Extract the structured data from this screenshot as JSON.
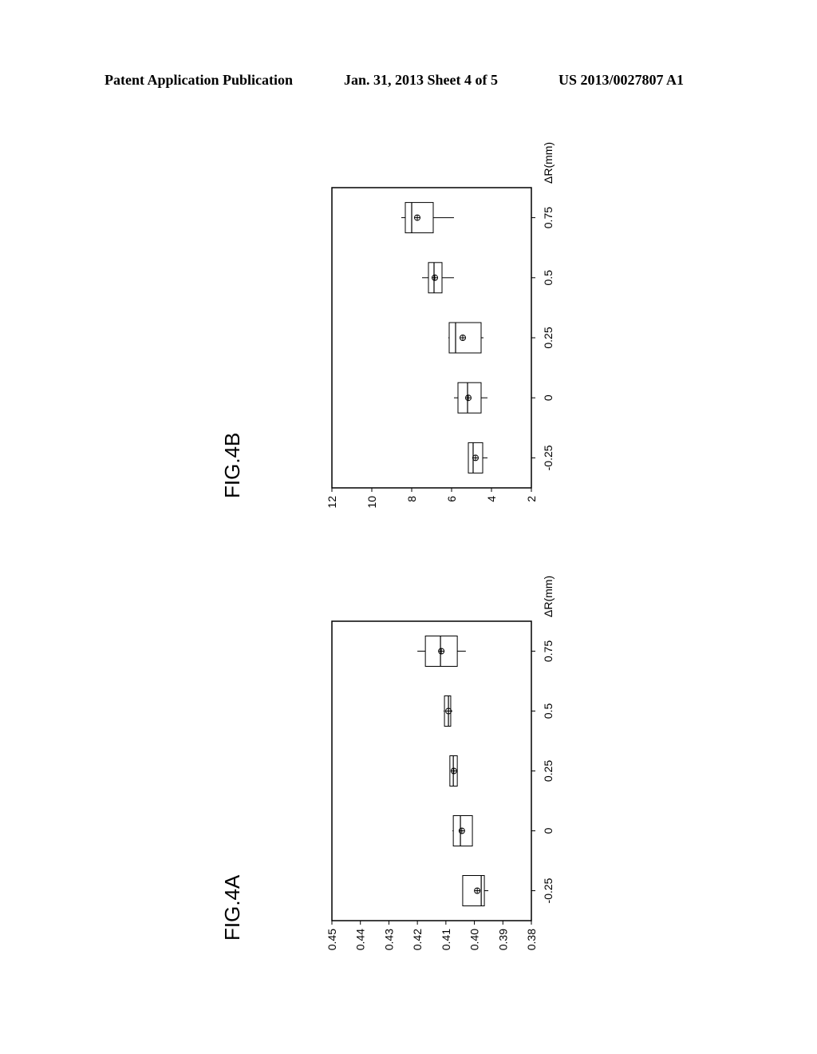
{
  "header": {
    "left": "Patent Application Publication",
    "middle": "Jan. 31, 2013  Sheet 4 of 5",
    "right": "US 2013/0027807 A1"
  },
  "figures": {
    "fig4a": {
      "label": "FIG.4A"
    },
    "fig4b": {
      "label": "FIG.4B"
    }
  },
  "chart_data": [
    {
      "id": "fig4a",
      "type": "boxplot",
      "title": "FIG.4A",
      "orientation": "page rotated 90° counter-clockwise",
      "xlabel": "ΔR(mm)",
      "ylabel": "",
      "categories": [
        "-0.25",
        "0",
        "0.25",
        "0.5",
        "0.75"
      ],
      "y_ticks": [
        "0.38",
        "0.39",
        "0.40",
        "0.41",
        "0.42",
        "0.43",
        "0.44",
        "0.45"
      ],
      "ylim": [
        0.38,
        0.45
      ],
      "grid": false,
      "legend": "none",
      "boxes": [
        {
          "category": "-0.25",
          "whisker_low": 0.3951,
          "q1": 0.3965,
          "median": 0.3976,
          "mean": 0.399,
          "q3": 0.4041,
          "whisker_high": 0.4041
        },
        {
          "category": "0",
          "whisker_low": 0.4007,
          "q1": 0.4007,
          "median": 0.4049,
          "mean": 0.4044,
          "q3": 0.4074,
          "whisker_high": 0.4077
        },
        {
          "category": "0.25",
          "whisker_low": 0.406,
          "q1": 0.406,
          "median": 0.4074,
          "mean": 0.4072,
          "q3": 0.4086,
          "whisker_high": 0.4086
        },
        {
          "category": "0.5",
          "whisker_low": 0.4077,
          "q1": 0.4083,
          "median": 0.4091,
          "mean": 0.4091,
          "q3": 0.4105,
          "whisker_high": 0.4108
        },
        {
          "category": "0.75",
          "whisker_low": 0.403,
          "q1": 0.406,
          "median": 0.4119,
          "mean": 0.4116,
          "q3": 0.4172,
          "whisker_high": 0.42
        }
      ]
    },
    {
      "id": "fig4b",
      "type": "boxplot",
      "title": "FIG.4B",
      "orientation": "page rotated 90° counter-clockwise",
      "xlabel": "ΔR(mm)",
      "ylabel": "",
      "categories": [
        "-0.25",
        "0",
        "0.25",
        "0.5",
        "0.75"
      ],
      "y_ticks": [
        "2",
        "4",
        "6",
        "8",
        "10",
        "12"
      ],
      "ylim": [
        2,
        12
      ],
      "grid": false,
      "legend": "none",
      "boxes": [
        {
          "category": "-0.25",
          "whisker_low": 4.2,
          "q1": 4.44,
          "median": 4.92,
          "mean": 4.8,
          "q3": 5.16,
          "whisker_high": 5.16
        },
        {
          "category": "0",
          "whisker_low": 4.2,
          "q1": 4.52,
          "median": 5.2,
          "mean": 5.16,
          "q3": 5.68,
          "whisker_high": 5.88
        },
        {
          "category": "0.25",
          "whisker_low": 4.4,
          "q1": 4.52,
          "median": 5.8,
          "mean": 5.44,
          "q3": 6.12,
          "whisker_high": 6.16
        },
        {
          "category": "0.5",
          "whisker_low": 5.88,
          "q1": 6.48,
          "median": 6.88,
          "mean": 6.84,
          "q3": 7.16,
          "whisker_high": 7.48
        },
        {
          "category": "0.75",
          "whisker_low": 5.88,
          "q1": 6.92,
          "median": 8.0,
          "mean": 7.72,
          "q3": 8.32,
          "whisker_high": 8.52
        }
      ]
    }
  ]
}
